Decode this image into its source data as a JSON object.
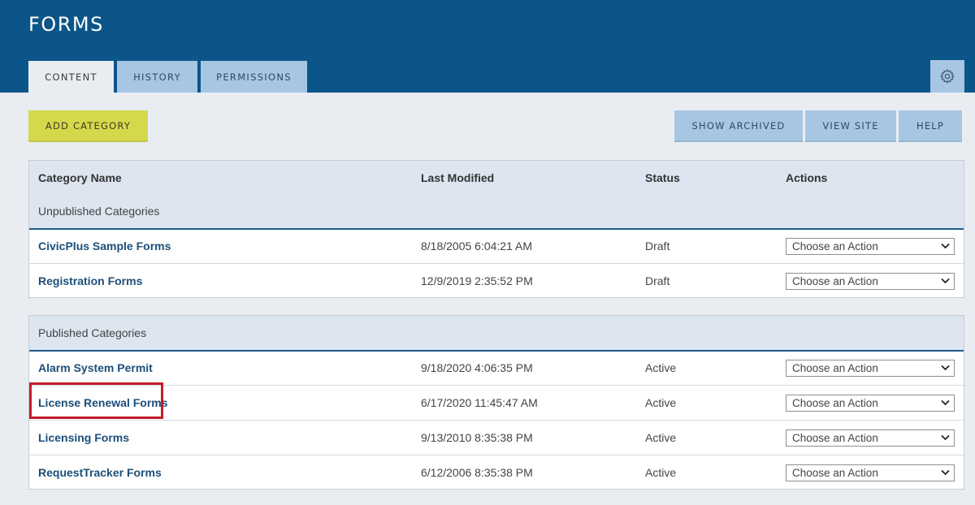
{
  "header": {
    "title": "FORMS",
    "tabs": [
      {
        "label": "CONTENT",
        "active": true
      },
      {
        "label": "HISTORY",
        "active": false
      },
      {
        "label": "PERMISSIONS",
        "active": false
      }
    ],
    "settings_icon": "gear-icon"
  },
  "toolbar": {
    "add_category_label": "ADD CATEGORY",
    "show_archived_label": "SHOW ARCHIVED",
    "view_site_label": "VIEW SITE",
    "help_label": "HELP"
  },
  "table": {
    "columns": [
      "Category Name",
      "Last Modified",
      "Status",
      "Actions"
    ],
    "unpublished": {
      "label": "Unpublished Categories",
      "rows": [
        {
          "name": "CivicPlus Sample Forms",
          "modified": "8/18/2005 6:04:21 AM",
          "status": "Draft",
          "action": "Choose an Action"
        },
        {
          "name": "Registration Forms",
          "modified": "12/9/2019 2:35:52 PM",
          "status": "Draft",
          "action": "Choose an Action"
        }
      ]
    },
    "published": {
      "label": "Published Categories",
      "rows": [
        {
          "name": "Alarm System Permit",
          "modified": "9/18/2020 4:06:35 PM",
          "status": "Active",
          "action": "Choose an Action"
        },
        {
          "name": "License Renewal Forms",
          "modified": "6/17/2020 11:45:47 AM",
          "status": "Active",
          "action": "Choose an Action"
        },
        {
          "name": "Licensing Forms",
          "modified": "9/13/2010 8:35:38 PM",
          "status": "Active",
          "action": "Choose an Action"
        },
        {
          "name": "RequestTracker Forms",
          "modified": "6/12/2006 8:35:38 PM",
          "status": "Active",
          "action": "Choose an Action"
        }
      ]
    }
  },
  "colors": {
    "header_bg": "#0c5588",
    "tab_bg": "#a7c6e3",
    "add_button_bg": "#d4d84b",
    "link": "#1c4f7a",
    "highlight": "#c41c2b"
  }
}
